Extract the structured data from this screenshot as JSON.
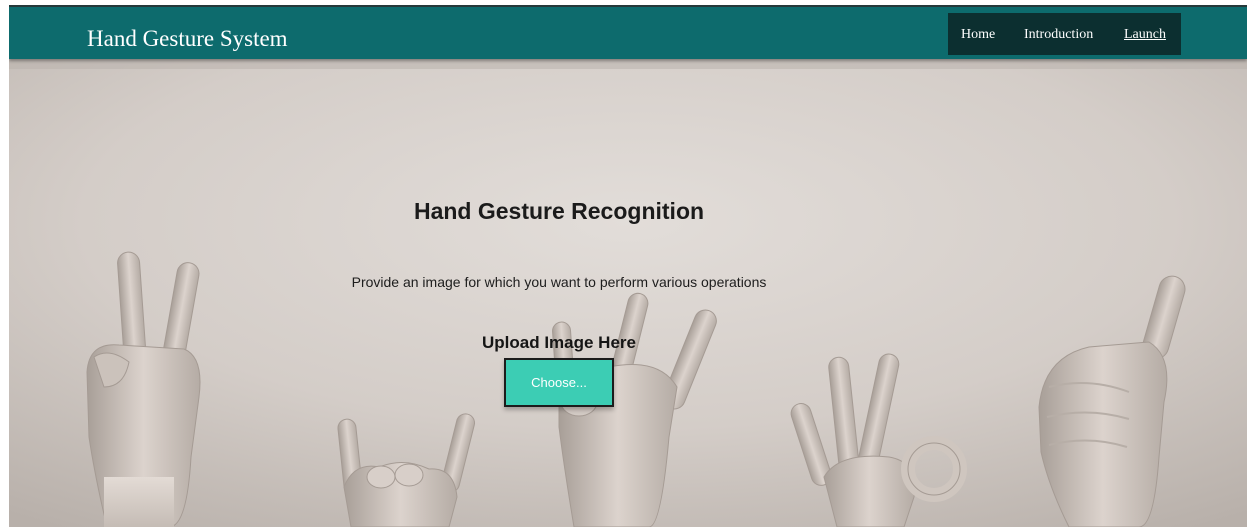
{
  "app": {
    "brand_title": "Hand Gesture System"
  },
  "nav": {
    "items": [
      {
        "label": "Home"
      },
      {
        "label": "Introduction"
      },
      {
        "label": "Launch",
        "active": true
      }
    ]
  },
  "hero": {
    "title": "Hand Gesture Recognition",
    "subtitle": "Provide an image for which you want to perform various operations",
    "upload_label": "Upload Image Here",
    "choose_button_label": "Choose..."
  },
  "colors": {
    "header": "#0d6b6d",
    "nav_box": "#0c2f30",
    "background": "#d6d0cb",
    "choose_button": "#3ccdb4"
  },
  "icons": [
    "peace-sign-hand",
    "rock-sign-hand",
    "victory-hand",
    "ok-sign-hand",
    "thumbs-up-hand"
  ]
}
